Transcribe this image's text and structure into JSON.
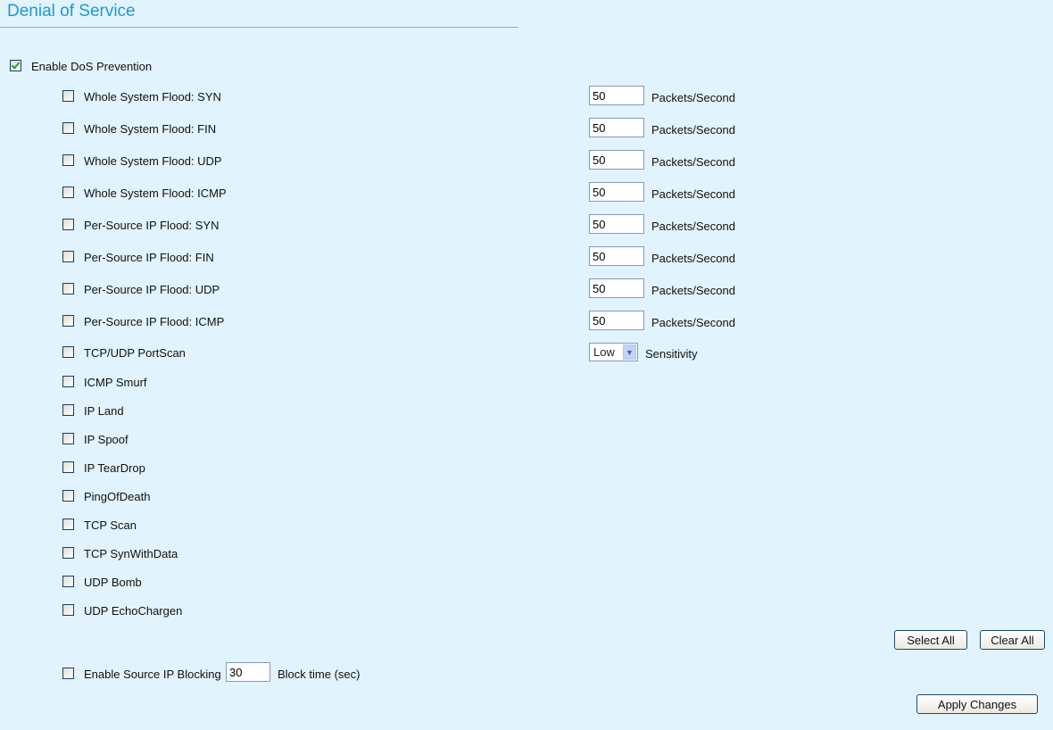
{
  "title": "Denial of Service",
  "enable_dos": {
    "label": "Enable DoS Prevention",
    "checked": true
  },
  "flood_unit": "Packets/Second",
  "floods": [
    {
      "label": "Whole System Flood: SYN",
      "value": "50",
      "checked": false
    },
    {
      "label": "Whole System Flood: FIN",
      "value": "50",
      "checked": false
    },
    {
      "label": "Whole System Flood: UDP",
      "value": "50",
      "checked": false
    },
    {
      "label": "Whole System Flood: ICMP",
      "value": "50",
      "checked": false
    },
    {
      "label": "Per-Source IP Flood: SYN",
      "value": "50",
      "checked": false
    },
    {
      "label": "Per-Source IP Flood: FIN",
      "value": "50",
      "checked": false
    },
    {
      "label": "Per-Source IP Flood: UDP",
      "value": "50",
      "checked": false
    },
    {
      "label": "Per-Source IP Flood: ICMP",
      "value": "50",
      "checked": false
    }
  ],
  "portscan": {
    "label": "TCP/UDP PortScan",
    "checked": false,
    "sensitivity": "Low",
    "sensitivity_label": "Sensitivity"
  },
  "attacks": [
    {
      "label": "ICMP Smurf",
      "checked": false
    },
    {
      "label": "IP Land",
      "checked": false
    },
    {
      "label": "IP Spoof",
      "checked": false
    },
    {
      "label": "IP TearDrop",
      "checked": false
    },
    {
      "label": "PingOfDeath",
      "checked": false
    },
    {
      "label": "TCP Scan",
      "checked": false
    },
    {
      "label": "TCP SynWithData",
      "checked": false
    },
    {
      "label": "UDP Bomb",
      "checked": false
    },
    {
      "label": "UDP EchoChargen",
      "checked": false
    }
  ],
  "buttons": {
    "select_all": "Select All",
    "clear_all": "Clear All",
    "apply": "Apply Changes"
  },
  "source_ip_blocking": {
    "label": "Enable Source IP Blocking",
    "checked": false,
    "value": "30",
    "unit": "Block time (sec)"
  }
}
